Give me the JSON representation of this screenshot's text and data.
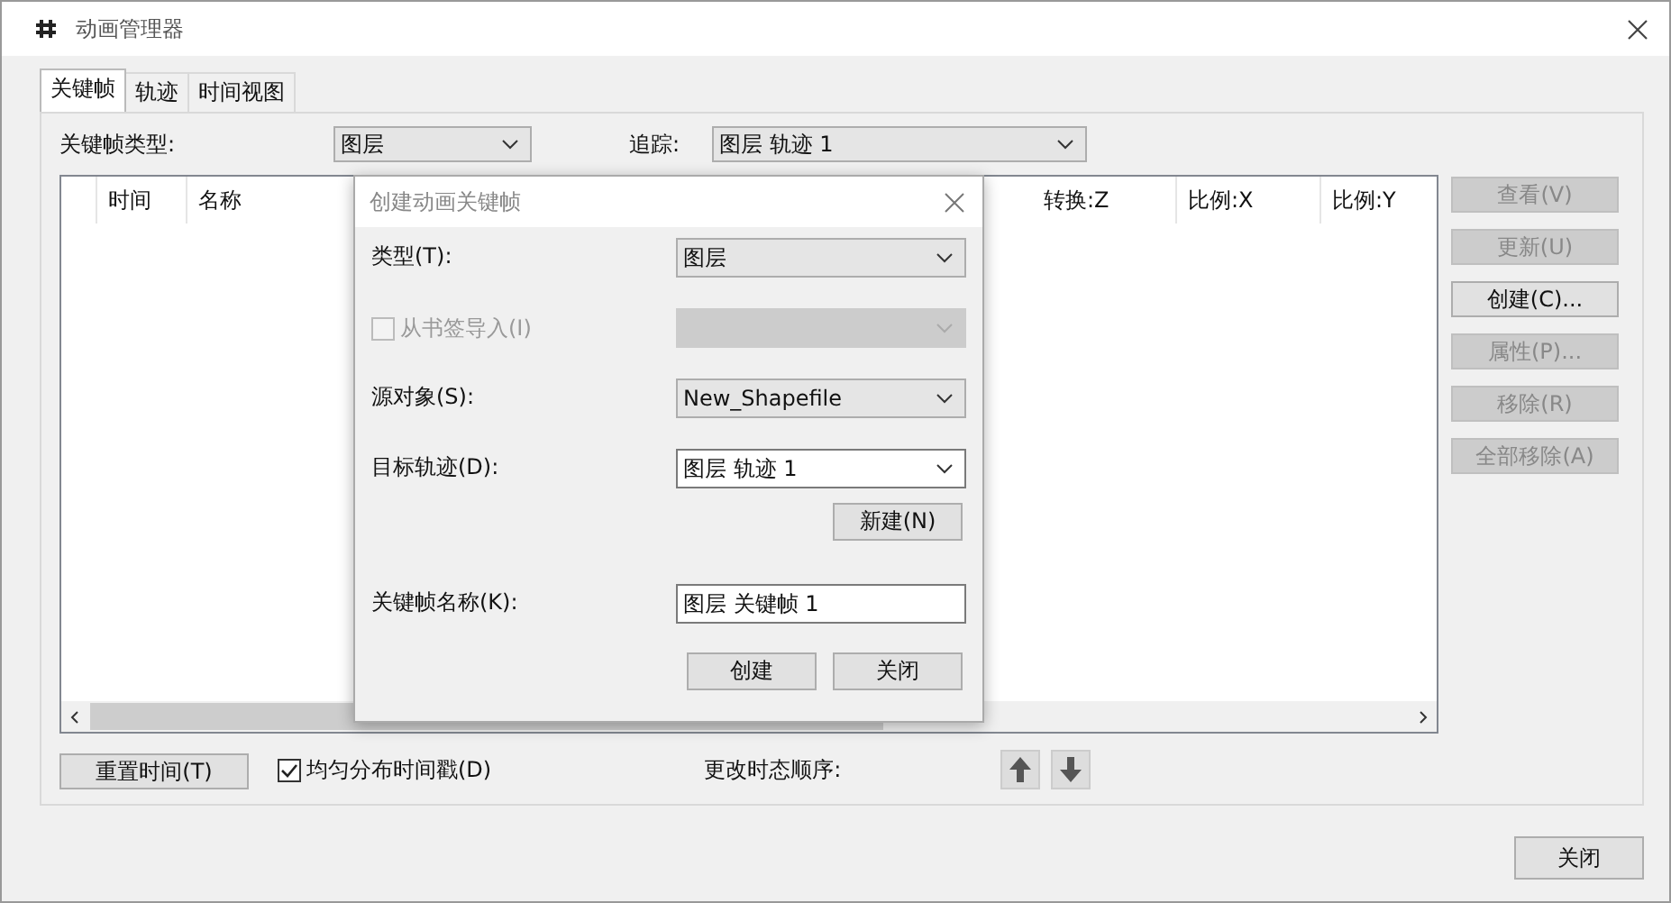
{
  "window": {
    "title": "动画管理器"
  },
  "tabs": [
    {
      "label": "关键帧",
      "selected": true
    },
    {
      "label": "轨迹",
      "selected": false
    },
    {
      "label": "时间视图",
      "selected": false
    }
  ],
  "keyframe_type": {
    "label": "关键帧类型:",
    "value": "图层"
  },
  "track": {
    "label": "追踪:",
    "value": "图层 轨迹 1"
  },
  "table": {
    "columns": [
      "时间",
      "名称",
      "转换:Z",
      "比例:X",
      "比例:Y"
    ]
  },
  "side_buttons": [
    {
      "label": "查看(V)",
      "disabled": true
    },
    {
      "label": "更新(U)",
      "disabled": true
    },
    {
      "label": "创建(C)...",
      "disabled": false
    },
    {
      "label": "属性(P)...",
      "disabled": true
    },
    {
      "label": "移除(R)",
      "disabled": true
    },
    {
      "label": "全部移除(A)",
      "disabled": true
    }
  ],
  "reset_button": "重置时间(T)",
  "distribute": {
    "label": "均匀分布时间戳(D)",
    "checked": true
  },
  "order_label": "更改时态顺序:",
  "close_button": "关闭",
  "dialog": {
    "title": "创建动画关键帧",
    "fields": [
      {
        "kind": "select",
        "label": "类型(T):",
        "value": "图层",
        "disabled": false
      },
      {
        "kind": "check-select",
        "label": "从书签导入(I)",
        "checked": false,
        "disabled": true
      },
      {
        "kind": "select",
        "label": "源对象(S):",
        "value": "New_Shapefile",
        "disabled": false
      },
      {
        "kind": "combo",
        "label": "目标轨迹(D):",
        "value": "图层 轨迹 1",
        "disabled": false,
        "button": "新建(N)"
      },
      {
        "kind": "input",
        "label": "关键帧名称(K):",
        "value": "图层 关键帧 1",
        "disabled": false
      }
    ],
    "buttons": [
      "创建",
      "关闭"
    ]
  }
}
